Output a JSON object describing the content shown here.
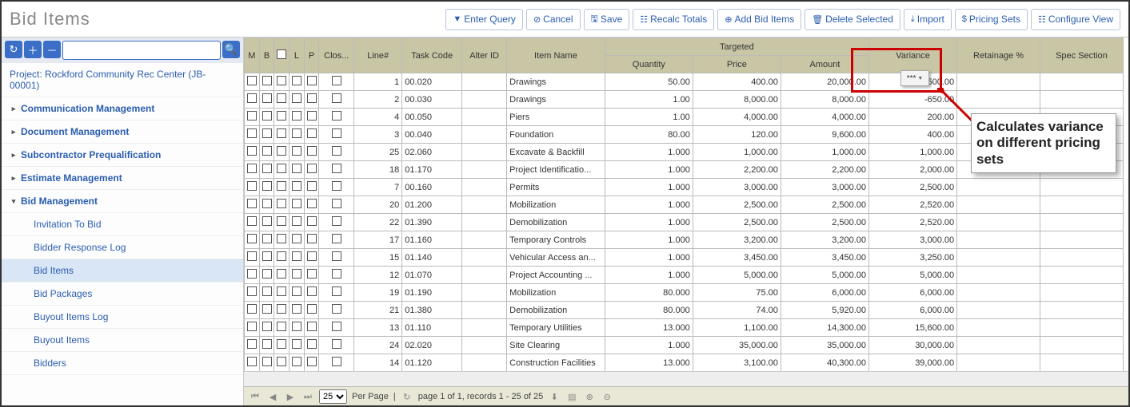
{
  "page_title": "Bid Items",
  "toolbar": [
    {
      "icon": "▼",
      "label": "Enter Query"
    },
    {
      "icon": "⊘",
      "label": "Cancel"
    },
    {
      "icon": "🖫",
      "label": "Save"
    },
    {
      "icon": "☷",
      "label": "Recalc Totals"
    },
    {
      "icon": "⊕",
      "label": "Add Bid Items"
    },
    {
      "icon": "🗑",
      "label": "Delete Selected"
    },
    {
      "icon": "⤓",
      "label": "Import"
    },
    {
      "icon": "$",
      "label": "Pricing Sets"
    },
    {
      "icon": "☷",
      "label": "Configure View"
    }
  ],
  "project_label": "Project: Rockford Community Rec Center (JB-00001)",
  "sidebar_groups": [
    {
      "label": "Communication Management",
      "expanded": false
    },
    {
      "label": "Document Management",
      "expanded": false
    },
    {
      "label": "Subcontractor Prequalification",
      "expanded": false
    },
    {
      "label": "Estimate Management",
      "expanded": false
    },
    {
      "label": "Bid Management",
      "expanded": true,
      "items": [
        "Invitation To Bid",
        "Bidder Response Log",
        "Bid Items",
        "Bid Packages",
        "Buyout Items Log",
        "Buyout Items",
        "Bidders"
      ]
    }
  ],
  "active_item": "Bid Items",
  "columns": {
    "m": "M",
    "b": "B",
    "chk": "",
    "l": "L",
    "p": "P",
    "clos": "Clos...",
    "line": "Line#",
    "task": "Task Code",
    "alter": "Alter ID",
    "item": "Item Name",
    "targeted": "Targeted",
    "qty": "Quantity",
    "price": "Price",
    "amount": "Amount",
    "variance": "Variance",
    "ret": "Retainage %",
    "spec": "Spec Section"
  },
  "variance_badge": "***",
  "rows": [
    {
      "line": 1,
      "task": "00.020",
      "alter": "",
      "item": "Drawings",
      "qty": "50.00",
      "price": "400.00",
      "amount": "20,000.00",
      "variance": "-2,500.00"
    },
    {
      "line": 2,
      "task": "00.030",
      "alter": "",
      "item": "Drawings",
      "qty": "1.00",
      "price": "8,000.00",
      "amount": "8,000.00",
      "variance": "-650.00"
    },
    {
      "line": 4,
      "task": "00.050",
      "alter": "",
      "item": "Piers",
      "qty": "1.00",
      "price": "4,000.00",
      "amount": "4,000.00",
      "variance": "200.00"
    },
    {
      "line": 3,
      "task": "00.040",
      "alter": "",
      "item": "Foundation",
      "qty": "80.00",
      "price": "120.00",
      "amount": "9,600.00",
      "variance": "400.00"
    },
    {
      "line": 25,
      "task": "02.060",
      "alter": "",
      "item": "Excavate & Backfill",
      "qty": "1.000",
      "price": "1,000.00",
      "amount": "1,000.00",
      "variance": "1,000.00"
    },
    {
      "line": 18,
      "task": "01.170",
      "alter": "",
      "item": "Project Identificatio...",
      "qty": "1.000",
      "price": "2,200.00",
      "amount": "2,200.00",
      "variance": "2,000.00"
    },
    {
      "line": 7,
      "task": "00.160",
      "alter": "",
      "item": "Permits",
      "qty": "1.000",
      "price": "3,000.00",
      "amount": "3,000.00",
      "variance": "2,500.00"
    },
    {
      "line": 20,
      "task": "01.200",
      "alter": "",
      "item": "Mobilization",
      "qty": "1.000",
      "price": "2,500.00",
      "amount": "2,500.00",
      "variance": "2,520.00"
    },
    {
      "line": 22,
      "task": "01.390",
      "alter": "",
      "item": "Demobilization",
      "qty": "1.000",
      "price": "2,500.00",
      "amount": "2,500.00",
      "variance": "2,520.00"
    },
    {
      "line": 17,
      "task": "01.160",
      "alter": "",
      "item": "Temporary Controls",
      "qty": "1.000",
      "price": "3,200.00",
      "amount": "3,200.00",
      "variance": "3,000.00"
    },
    {
      "line": 15,
      "task": "01.140",
      "alter": "",
      "item": "Vehicular Access an...",
      "qty": "1.000",
      "price": "3,450.00",
      "amount": "3,450.00",
      "variance": "3,250.00"
    },
    {
      "line": 12,
      "task": "01.070",
      "alter": "",
      "item": "Project Accounting ...",
      "qty": "1.000",
      "price": "5,000.00",
      "amount": "5,000.00",
      "variance": "5,000.00"
    },
    {
      "line": 19,
      "task": "01.190",
      "alter": "",
      "item": "Mobilization",
      "qty": "80.000",
      "price": "75.00",
      "amount": "6,000.00",
      "variance": "6,000.00"
    },
    {
      "line": 21,
      "task": "01.380",
      "alter": "",
      "item": "Demobilization",
      "qty": "80.000",
      "price": "74.00",
      "amount": "5,920.00",
      "variance": "6,000.00"
    },
    {
      "line": 13,
      "task": "01.110",
      "alter": "",
      "item": "Temporary Utilities",
      "qty": "13.000",
      "price": "1,100.00",
      "amount": "14,300.00",
      "variance": "15,600.00"
    },
    {
      "line": 24,
      "task": "02.020",
      "alter": "",
      "item": "Site Clearing",
      "qty": "1.000",
      "price": "35,000.00",
      "amount": "35,000.00",
      "variance": "30,000.00"
    },
    {
      "line": 14,
      "task": "01.120",
      "alter": "",
      "item": "Construction Facilities",
      "qty": "13.000",
      "price": "3,100.00",
      "amount": "40,300.00",
      "variance": "39,000.00"
    }
  ],
  "pager": {
    "per_page": "25",
    "per_page_label": "Per Page",
    "status": "page 1 of 1, records 1 - 25 of 25"
  },
  "callout_text": "Calculates variance on different pricing sets",
  "search_placeholder": ""
}
